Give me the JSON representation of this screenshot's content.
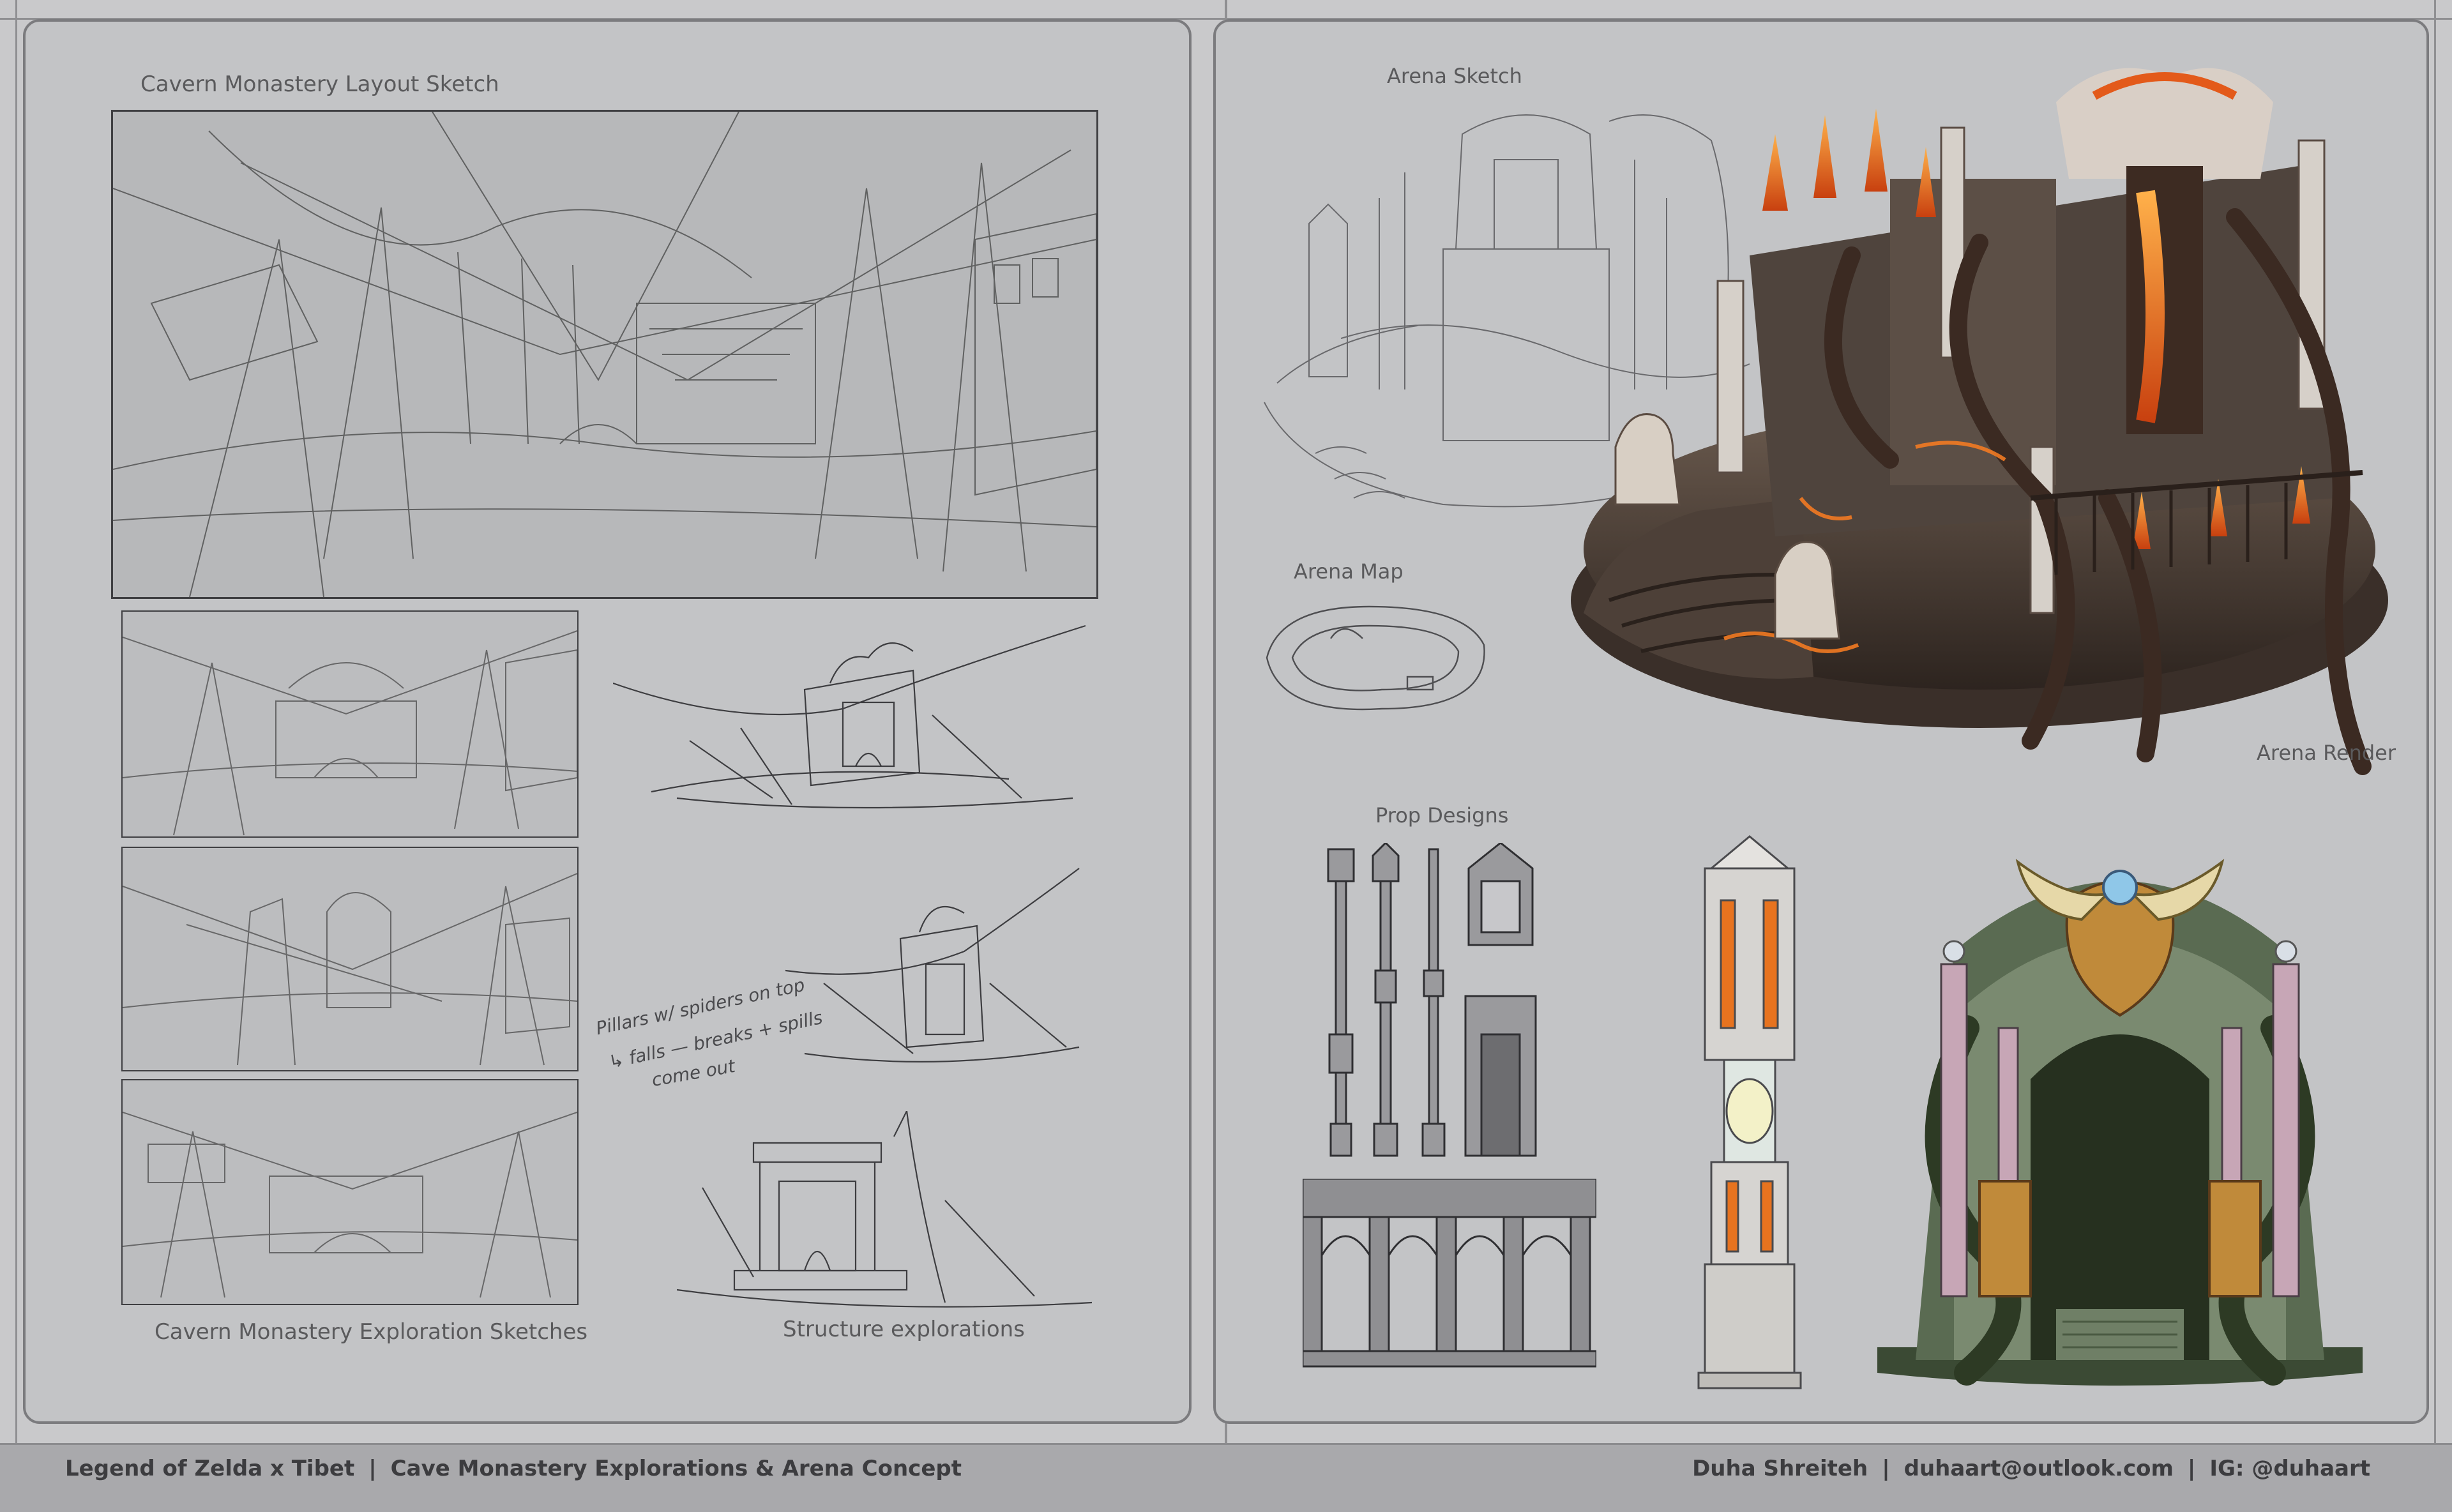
{
  "left_page": {
    "layout_sketch_label": "Cavern Monastery Layout Sketch",
    "exploration_sketches_label": "Cavern Monastery Exploration Sketches",
    "structure_explorations_label": "Structure explorations",
    "handwritten_notes": [
      "Pillars w/ spiders on top",
      "↳ falls — breaks + spills",
      "come out"
    ]
  },
  "right_page": {
    "arena_sketch_label": "Arena Sketch",
    "arena_map_label": "Arena Map",
    "arena_render_label": "Arena Render",
    "prop_designs_label": "Prop Designs"
  },
  "footer": {
    "project": "Legend of Zelda x Tibet",
    "subtitle": "Cave Monastery Explorations & Arena Concept",
    "artist": "Duha Shreiteh",
    "email": "duhaart@outlook.com",
    "instagram": "IG: @duhaart",
    "separator": "|"
  },
  "colors": {
    "page_bg": "#c3c4c6",
    "frame": "#7b7b7e",
    "footer_bg": "#a9a9ac",
    "accent_lava": "#e0601c",
    "stone": "#5a4a40"
  }
}
